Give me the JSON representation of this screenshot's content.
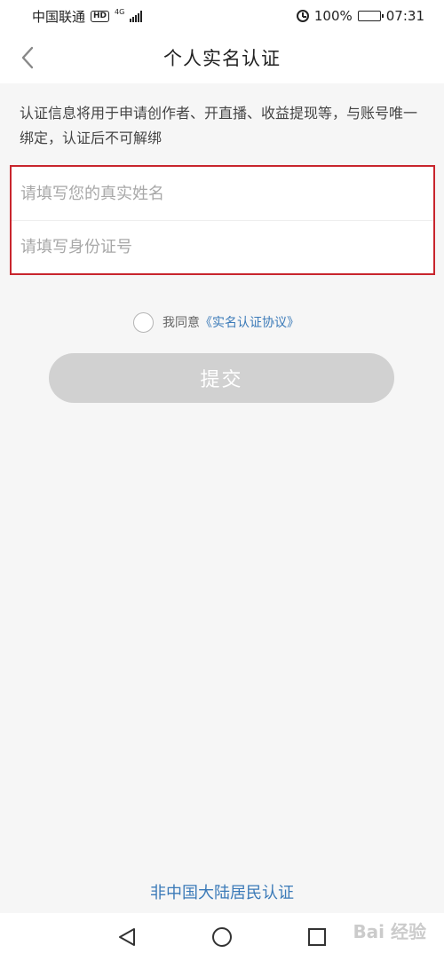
{
  "status_bar": {
    "carrier": "中国联通",
    "hd_badge": "HD",
    "network": "4G",
    "battery": "100%",
    "battery_level": 1.0,
    "time": "07:31"
  },
  "header": {
    "title": "个人实名认证"
  },
  "info": {
    "text": "认证信息将用于申请创作者、开直播、收益提现等，与账号唯一绑定，认证后不可解绑"
  },
  "form": {
    "name_placeholder": "请填写您的真实姓名",
    "name_value": "",
    "id_placeholder": "请填写身份证号",
    "id_value": ""
  },
  "agreement": {
    "prefix": "我同意",
    "link": "《实名认证协议》",
    "checked": false
  },
  "actions": {
    "submit_label": "提交",
    "non_mainland_label": "非中国大陆居民认证"
  },
  "watermark": {
    "text": "Bai 经验"
  },
  "colors": {
    "accent_link": "#3b7ab8",
    "highlight_border": "#c8252d",
    "disabled_button": "#d1d1d1"
  },
  "icons": {
    "back": "chevron-left-icon",
    "alarm": "alarm-icon",
    "sys_back": "triangle-back-icon",
    "sys_home": "circle-home-icon",
    "sys_recent": "square-recent-icon"
  }
}
